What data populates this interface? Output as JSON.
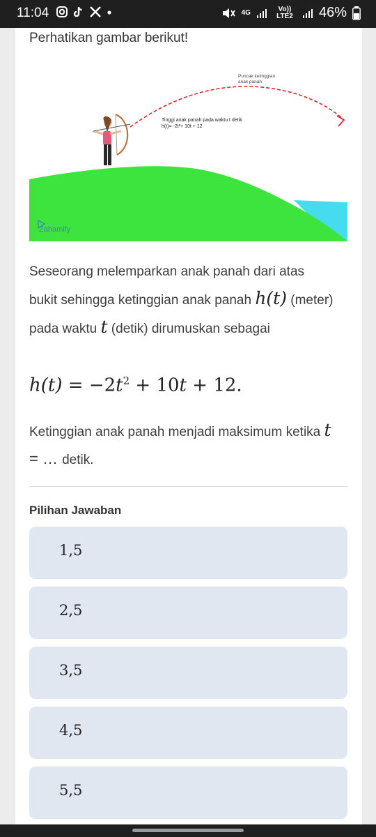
{
  "status_bar": {
    "time": "11:04",
    "network_4g": "4G",
    "network_volte": "Vo)) LTE2",
    "battery": "46%"
  },
  "question": {
    "heading": "Perhatikan gambar berikut!",
    "illustration": {
      "peak_label_line1": "Puncak ketinggian",
      "peak_label_line2": "anak panah",
      "height_label_line1": "Tinggi anak panah pada waktu t detik",
      "height_label_line2": "h(t)= -2t²+ 10t + 12",
      "watermark": "Zahamify",
      "colors": {
        "hill": "#3de43d",
        "water": "#45dcf0",
        "path": "#e0262e"
      }
    },
    "para1_a": "Seseorang melemparkan anak panah dari atas bukit sehingga ketinggian anak panah",
    "para1_math": "h(t)",
    "para1_b": "(meter) pada waktu",
    "para1_t": "t",
    "para1_c": "(detik) dirumuskan sebagai",
    "formula_lhs": "h(t)",
    "formula_eq": " = −2",
    "formula_t": "t",
    "formula_exp": "2",
    "formula_mid": " + 10",
    "formula_t2": "t",
    "formula_end": " + 12.",
    "para2_a": "Ketinggian anak panah menjadi maksimum ketika",
    "para2_t": "t",
    "para2_b": " = … ",
    "para2_c": "detik."
  },
  "answers": {
    "title": "Pilihan Jawaban",
    "options": [
      "1,5",
      "2,5",
      "3,5",
      "4,5",
      "5,5"
    ]
  }
}
